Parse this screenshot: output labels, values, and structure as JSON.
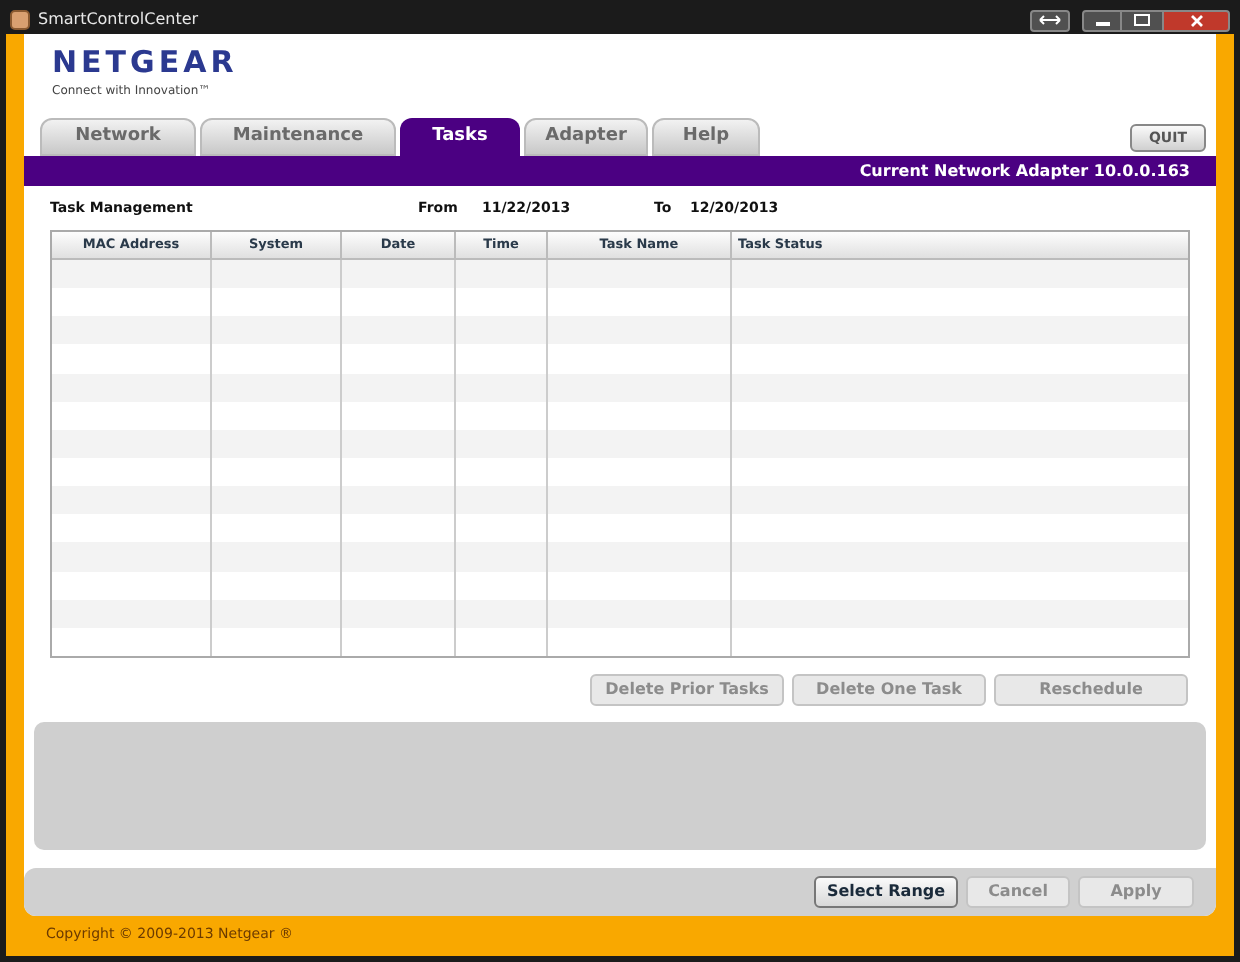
{
  "window": {
    "title": "SmartControlCenter"
  },
  "logo": {
    "brand": "NETGEAR",
    "tagline": "Connect with Innovation™"
  },
  "tabs": [
    {
      "label": "Network",
      "selected": false
    },
    {
      "label": "Maintenance",
      "selected": false
    },
    {
      "label": "Tasks",
      "selected": true
    },
    {
      "label": "Adapter",
      "selected": false
    },
    {
      "label": "Help",
      "selected": false
    }
  ],
  "quit_button": "QUIT",
  "adapter_bar": "Current Network Adapter 10.0.0.163",
  "task_panel": {
    "title": "Task Management",
    "from_label": "From",
    "from_value": "11/22/2013",
    "to_label": "To",
    "to_value": "12/20/2013"
  },
  "table": {
    "columns": [
      "MAC Address",
      "System",
      "Date",
      "Time",
      "Task Name",
      "Task Status"
    ]
  },
  "task_buttons": [
    {
      "label": "Delete Prior Tasks",
      "disabled": true
    },
    {
      "label": "Delete One Task",
      "disabled": true
    },
    {
      "label": "Reschedule",
      "disabled": true
    }
  ],
  "footer_buttons": [
    {
      "label": "Select Range",
      "disabled": false
    },
    {
      "label": "Cancel",
      "disabled": true
    },
    {
      "label": "Apply",
      "disabled": true
    }
  ],
  "status_bar": "Copyright © 2009-2013 Netgear ®"
}
